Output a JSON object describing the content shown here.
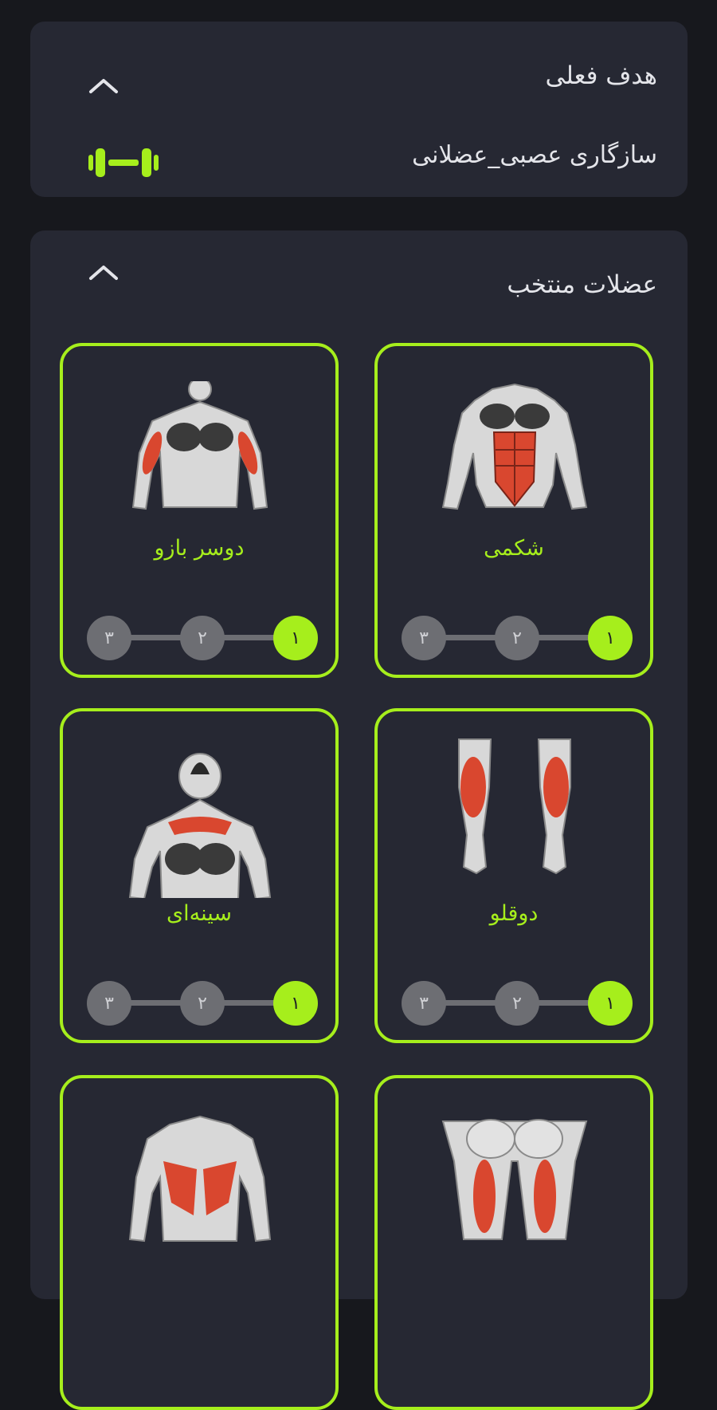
{
  "goal_panel": {
    "title": "هدف فعلی",
    "goal_text": "سازگاری عصبی_عضلانی",
    "goal_icon": "dumbbell-icon"
  },
  "muscles_panel": {
    "title": "عضلات منتخب",
    "cards": [
      {
        "label": "شکمی",
        "steps": [
          "۱",
          "۲",
          "۳"
        ],
        "selected_step": "۱"
      },
      {
        "label": "دوسر بازو",
        "steps": [
          "۱",
          "۲",
          "۳"
        ],
        "selected_step": "۱"
      },
      {
        "label": "دوقلو",
        "steps": [
          "۱",
          "۲",
          "۳"
        ],
        "selected_step": "۱"
      },
      {
        "label": "سینه‌ای",
        "steps": [
          "۱",
          "۲",
          "۳"
        ],
        "selected_step": "۱"
      },
      {
        "label": "",
        "steps": [],
        "selected_step": ""
      },
      {
        "label": "",
        "steps": [],
        "selected_step": ""
      }
    ]
  },
  "colors": {
    "accent": "#a6ee1c",
    "panel_bg": "#262833",
    "page_bg": "#17181d",
    "step_inactive": "#6d6e73",
    "muscle_highlight": "#d9472f"
  }
}
